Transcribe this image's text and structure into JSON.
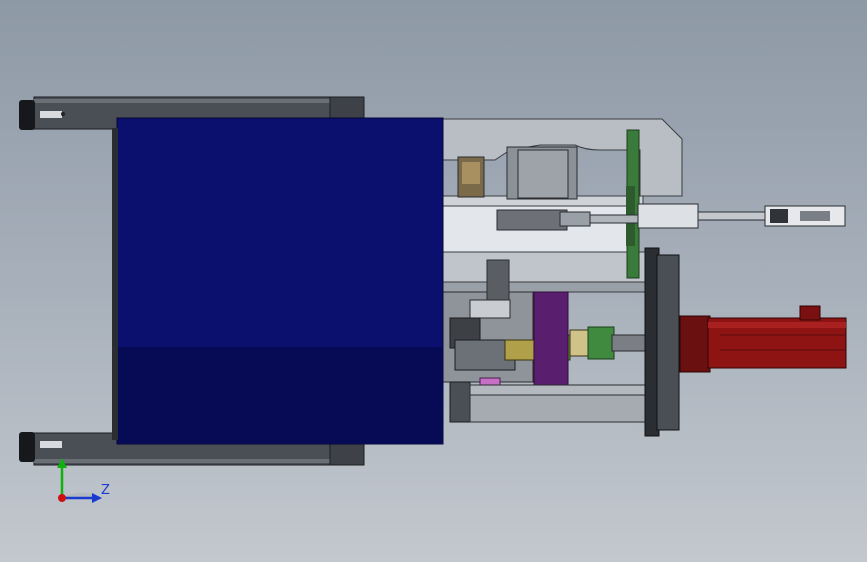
{
  "viewport": {
    "background_top": "#8e99a6",
    "background_bottom": "#c3c8ce"
  },
  "triad": {
    "axis_label_z": "Z",
    "color_x": "#d01010",
    "color_y": "#10b010",
    "color_z": "#1a3bd0"
  },
  "model": {
    "enclosure_color": "#0b0f6e",
    "motor_color": "#8e1414",
    "frame_color": "#5a5f66",
    "plate_color": "#b9bec4",
    "pad_color": "#5a1e6e"
  }
}
